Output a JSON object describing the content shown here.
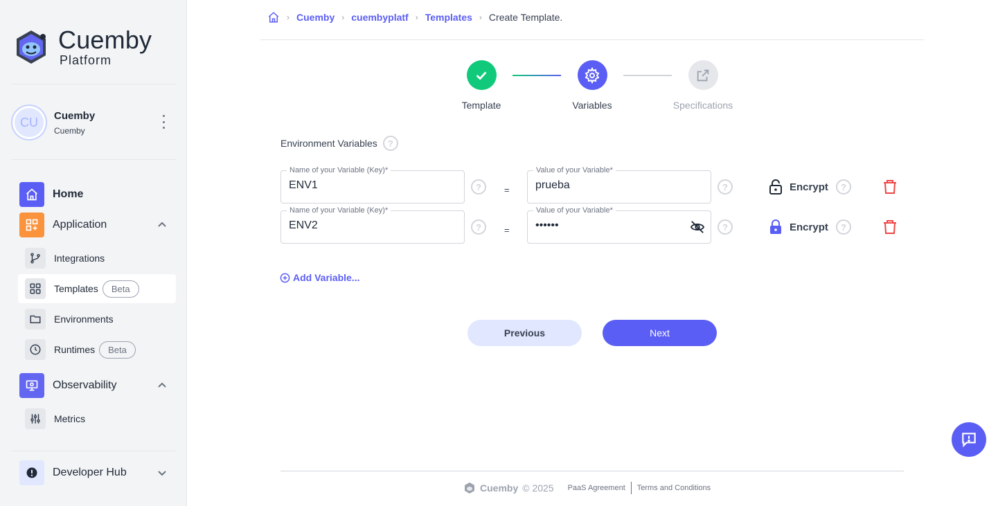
{
  "brand": {
    "name": "Cuemby",
    "subtitle": "Platform"
  },
  "user": {
    "initials": "CU",
    "name": "Cuemby",
    "org": "Cuemby"
  },
  "nav": {
    "home": "Home",
    "application": "Application",
    "integrations": "Integrations",
    "templates": "Templates",
    "templates_badge": "Beta",
    "environments": "Environments",
    "runtimes": "Runtimes",
    "runtimes_badge": "Beta",
    "observability": "Observability",
    "metrics": "Metrics",
    "developer_hub": "Developer Hub"
  },
  "breadcrumb": {
    "b1": "Cuemby",
    "b2": "cuembyplatf",
    "b3": "Templates",
    "current": "Create Template."
  },
  "steps": {
    "s1": "Template",
    "s2": "Variables",
    "s3": "Specifications"
  },
  "env": {
    "title": "Environment Variables",
    "key_label": "Name of your Variable (Key)*",
    "value_label": "Value of your Variable*",
    "eq": "=",
    "encrypt_label": "Encrypt",
    "rows": [
      {
        "key": "ENV1",
        "value": "prueba"
      },
      {
        "key": "ENV2",
        "value": "••••••"
      }
    ]
  },
  "add_variable": "Add Variable...",
  "buttons": {
    "previous": "Previous",
    "next": "Next"
  },
  "footer": {
    "brand": "Cuemby",
    "copyright": "© 2025",
    "paas": "PaaS Agreement",
    "terms": "Terms and Conditions"
  },
  "colors": {
    "accent": "#5b5ef4",
    "success": "#10c97a",
    "danger": "#ef4444"
  }
}
